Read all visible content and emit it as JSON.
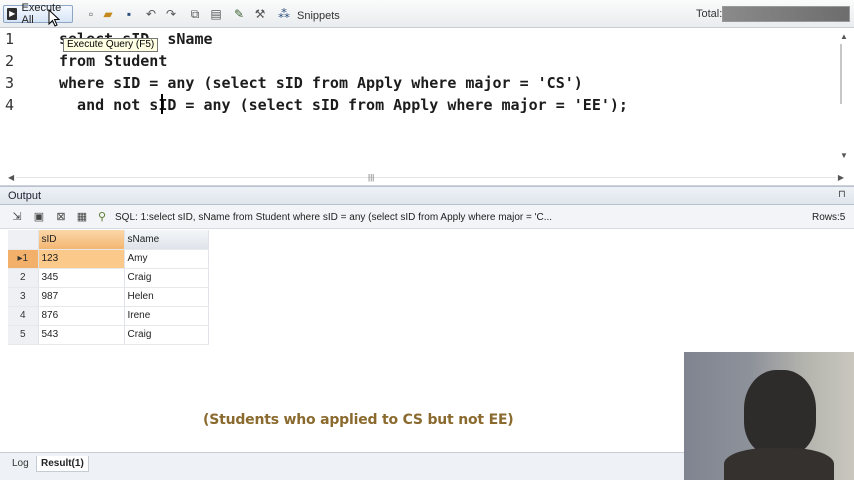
{
  "toolbar": {
    "execute_all_label": "Execute All",
    "snippets_label": "Snippets",
    "total_label": "Total:"
  },
  "tooltip": {
    "text": "Execute Query (F5)"
  },
  "editor": {
    "lines": [
      {
        "num": "1",
        "text": "select sID, sName"
      },
      {
        "num": "2",
        "text": "from Student"
      },
      {
        "num": "3",
        "text": "where sID = any (select sID from Apply where major = 'CS')"
      },
      {
        "num": "4",
        "text": "  and not sID = any (select sID from Apply where major = 'EE');"
      }
    ]
  },
  "output": {
    "title": "Output",
    "sql_summary": "SQL: 1:select sID, sName  from Student  where sID = any (select sID from Apply where major = 'C...",
    "rows_label": "Rows:5",
    "columns": [
      "sID",
      "sName"
    ],
    "rows": [
      {
        "num": "1",
        "sID": "123",
        "sName": "Amy"
      },
      {
        "num": "2",
        "sID": "345",
        "sName": "Craig"
      },
      {
        "num": "3",
        "sID": "987",
        "sName": "Helen"
      },
      {
        "num": "4",
        "sID": "876",
        "sName": "Irene"
      },
      {
        "num": "5",
        "sID": "543",
        "sName": "Craig"
      }
    ]
  },
  "caption": "(Students who applied to CS but not EE)",
  "tabs": {
    "log": "Log",
    "result": "Result(1)"
  },
  "icons": {
    "toolbar": [
      "execute-icon",
      "new-icon",
      "open-icon",
      "save-icon",
      "undo-icon",
      "redo-icon",
      "copy-icon",
      "paste-icon",
      "format-icon",
      "snippets-icon"
    ],
    "output": [
      "export-icon",
      "print-icon",
      "excel-icon",
      "clear-icon",
      "filter-icon"
    ]
  }
}
